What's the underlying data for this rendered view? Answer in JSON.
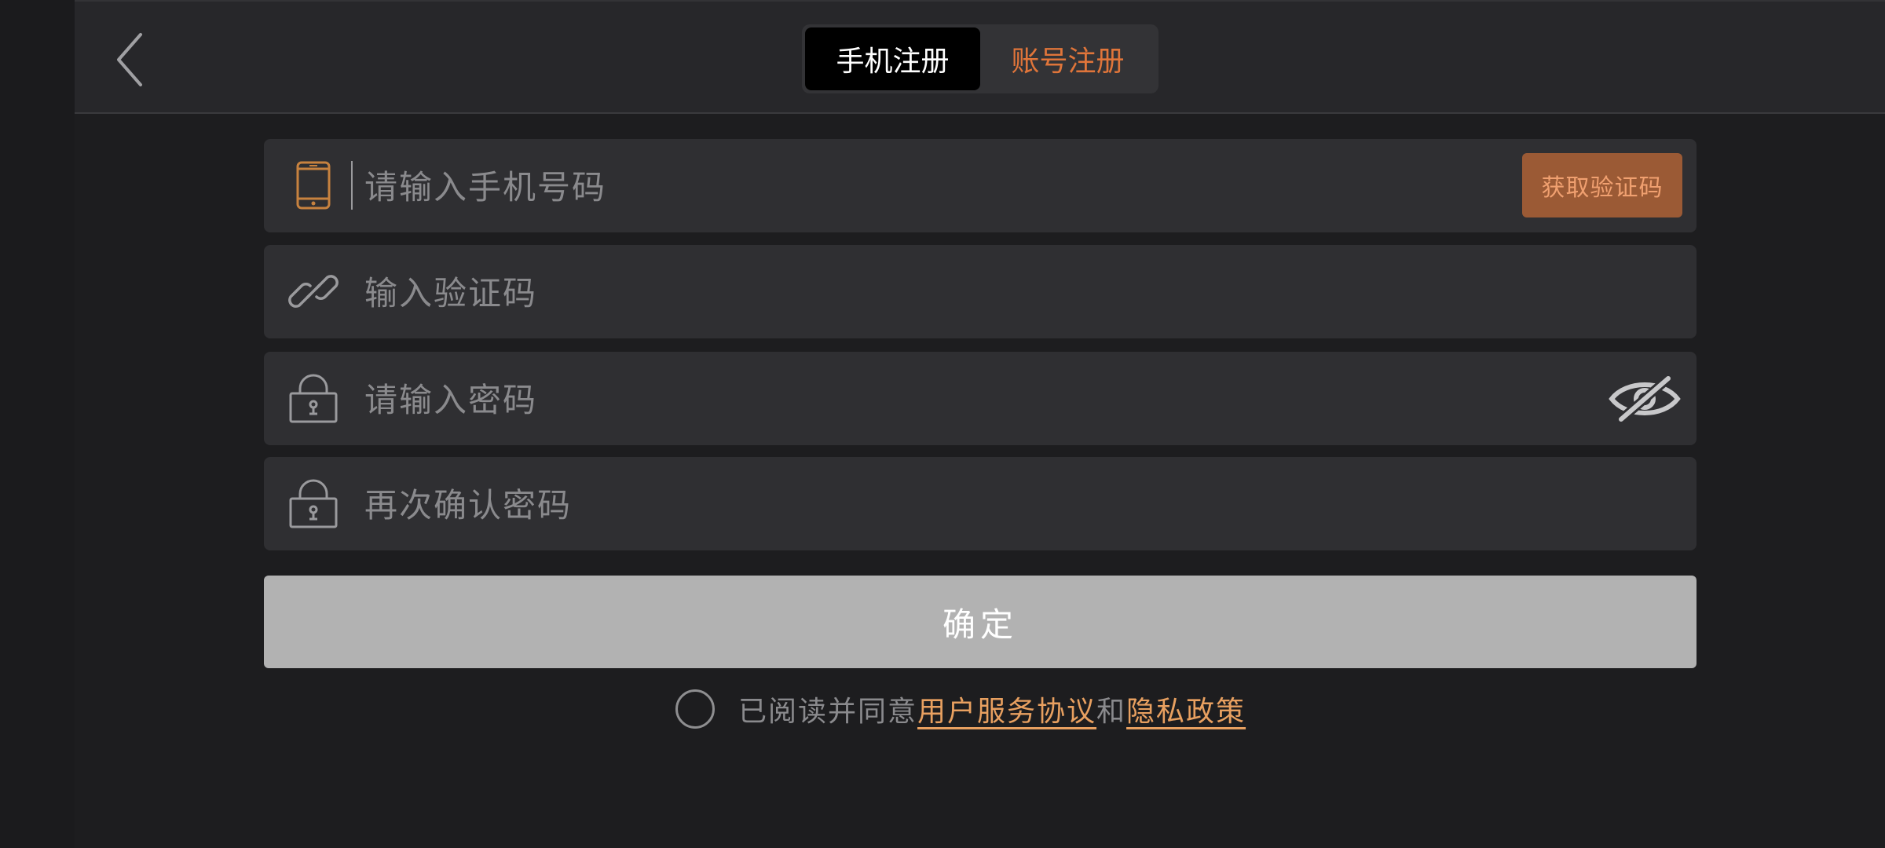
{
  "header": {
    "tabs": [
      {
        "label": "手机注册",
        "active": true
      },
      {
        "label": "账号注册",
        "active": false
      }
    ]
  },
  "form": {
    "phone": {
      "placeholder": "请输入手机号码",
      "value": "",
      "icon": "phone-icon"
    },
    "get_code_label": "获取验证码",
    "code": {
      "placeholder": "输入验证码",
      "value": "",
      "icon": "link-icon"
    },
    "password": {
      "placeholder": "请输入密码",
      "value": "",
      "icon": "lock-icon"
    },
    "confirm_password": {
      "placeholder": "再次确认密码",
      "value": "",
      "icon": "lock-icon"
    },
    "submit_label": "确定"
  },
  "agreement": {
    "prefix": "已阅读并同意",
    "terms_link": "用户服务协议",
    "and": "和",
    "privacy_link": "隐私政策",
    "checked": false
  },
  "colors": {
    "accent": "#e0753a",
    "link": "#e8a060",
    "code_button_bg": "#9b5a35",
    "submit_bg": "#b2b2b2",
    "field_bg": "#2f2f32"
  }
}
